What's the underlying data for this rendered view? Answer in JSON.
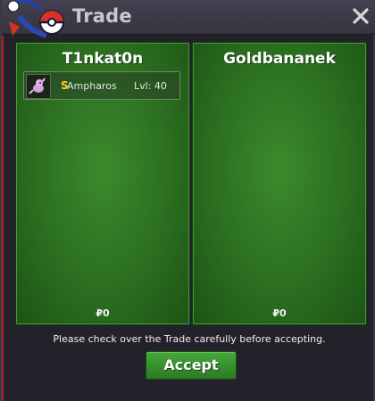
{
  "window": {
    "title": "Trade"
  },
  "left_panel": {
    "player_name": "T1nkat0n",
    "items": [
      {
        "shiny_marker": "S",
        "name": "Ampharos",
        "level": "Lvl: 40"
      }
    ],
    "money": "₽0"
  },
  "right_panel": {
    "player_name": "Goldbananek",
    "money": "₽0"
  },
  "footer": {
    "notice": "Please check over the Trade carefully before accepting.",
    "accept_label": "Accept"
  },
  "colors": {
    "panel_green": "#2b6e20",
    "accent_green": "#3c8a2c",
    "titlebar": "#3d3b47",
    "shiny_gold": "#ffcc22"
  },
  "icons": {
    "logo": "pokeball-logo-icon",
    "close": "close-icon",
    "sprite": "pokemon-sprite-icon"
  }
}
